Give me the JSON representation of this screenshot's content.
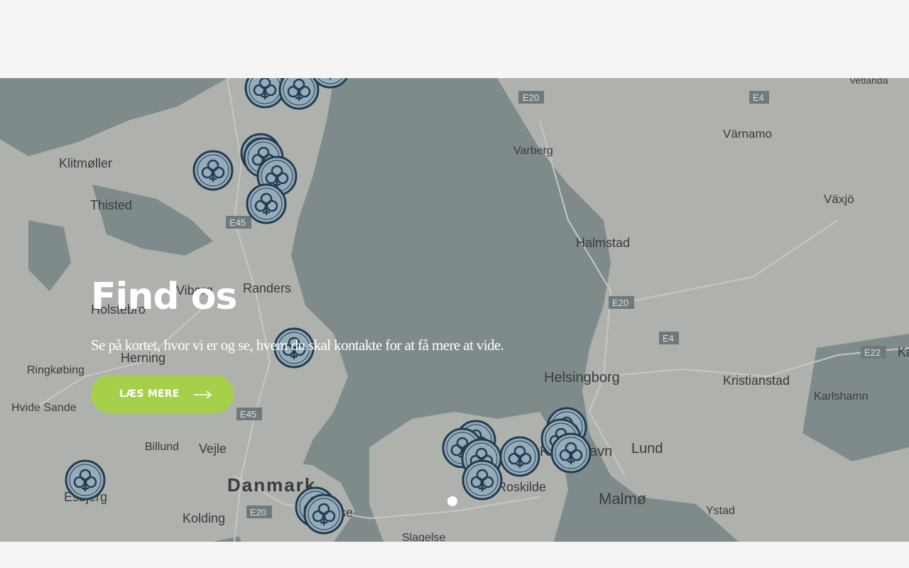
{
  "hero": {
    "title": "Find os",
    "text": "Se på kortet, hvor vi er og se, hvem du skal kontakte for at få mere at vide.",
    "cta_label": "LÆS MERE"
  },
  "map": {
    "places": [
      "Klitmøller",
      "Thisted",
      "Viborg",
      "Randers",
      "Holstebro",
      "Herning",
      "Ringkøbing",
      "Hvide Sande",
      "Billund",
      "Vejle",
      "Kolding",
      "Esbjerg",
      "Danmark",
      "Odense",
      "Slagelse",
      "Roskilde",
      "København",
      "Malmø",
      "Lund",
      "Ystad",
      "Helsingborg",
      "Halmstad",
      "Varberg",
      "Värnamo",
      "Växjö",
      "Kristianstad",
      "Karlshamn",
      "Vetlanda",
      "Ka"
    ],
    "roads": [
      "E20",
      "E4",
      "E45",
      "E45",
      "E20",
      "E4",
      "E22",
      "E20"
    ]
  },
  "colors": {
    "accent": "#a6cf4a",
    "marker": "#a9c2d3",
    "marker_outline": "#1e3a55"
  },
  "icons": {
    "marker": "scout-trefoil-icon",
    "arrow": "arrow-right-icon"
  }
}
